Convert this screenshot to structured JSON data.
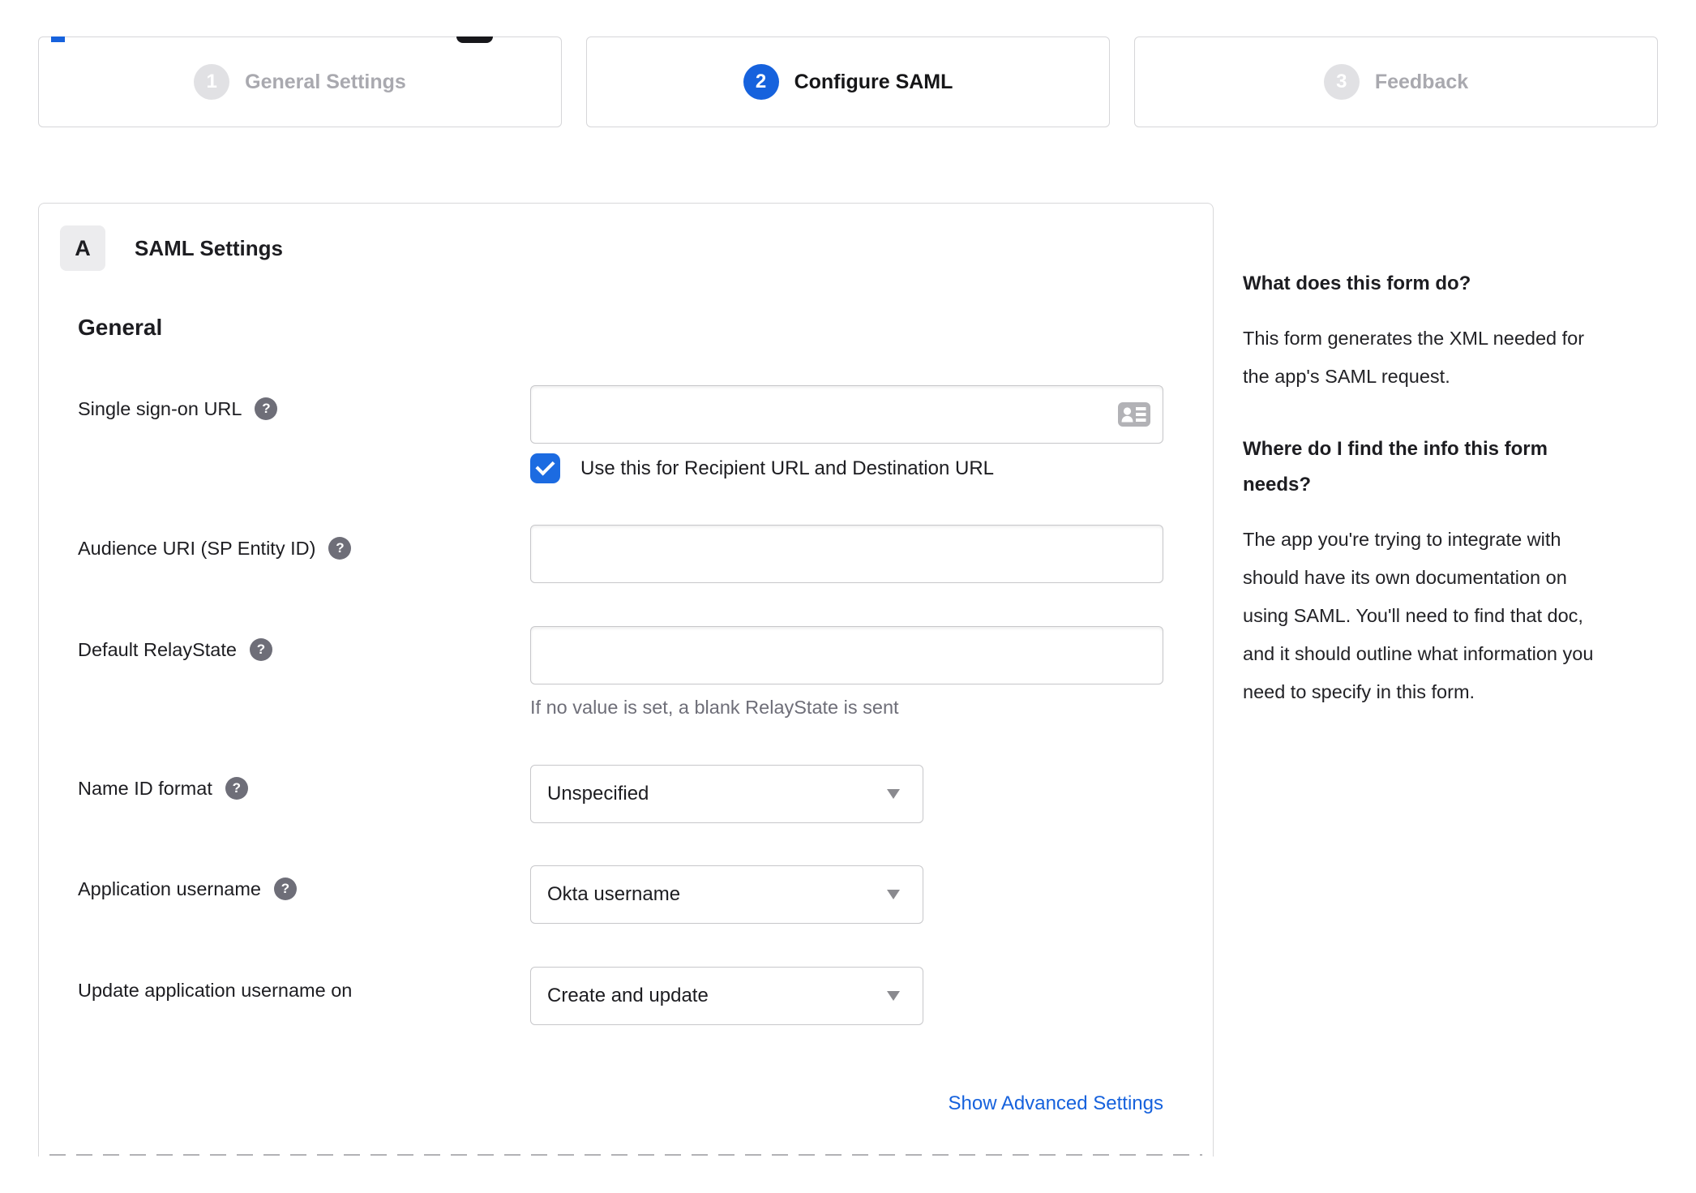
{
  "colors": {
    "accent_blue": "#1662dd",
    "checkbox_blue": "#1c6be1",
    "inactive_gray": "#a9a9af",
    "help_icon_gray": "#6e6e78"
  },
  "stepper": {
    "steps": [
      {
        "number": "1",
        "label": "General Settings",
        "state": "inactive"
      },
      {
        "number": "2",
        "label": "Configure SAML",
        "state": "active"
      },
      {
        "number": "3",
        "label": "Feedback",
        "state": "inactive"
      }
    ]
  },
  "form_panel": {
    "section_badge": "A",
    "section_title": "SAML Settings",
    "group_heading": "General",
    "sso": {
      "label": "Single sign-on URL",
      "value": "",
      "checkbox_checked": true,
      "checkbox_label": "Use this for Recipient URL and Destination URL"
    },
    "audience": {
      "label": "Audience URI (SP Entity ID)",
      "value": ""
    },
    "relay": {
      "label": "Default RelayState",
      "value": "",
      "hint": "If no value is set, a blank RelayState is sent"
    },
    "name_id": {
      "label": "Name ID format",
      "selected": "Unspecified"
    },
    "app_username": {
      "label": "Application username",
      "selected": "Okta username"
    },
    "update_username": {
      "label": "Update application username on",
      "selected": "Create and update"
    },
    "advanced_link": "Show Advanced Settings"
  },
  "help_panel": {
    "q1": "What does this form do?",
    "a1": "This form generates the XML needed for the app's SAML request.",
    "q2": "Where do I find the info this form needs?",
    "a2": "The app you're trying to integrate with should have its own documentation on using SAML. You'll need to find that doc, and it should outline what information you need to specify in this form."
  },
  "icons": {
    "help_glyph": "?"
  }
}
